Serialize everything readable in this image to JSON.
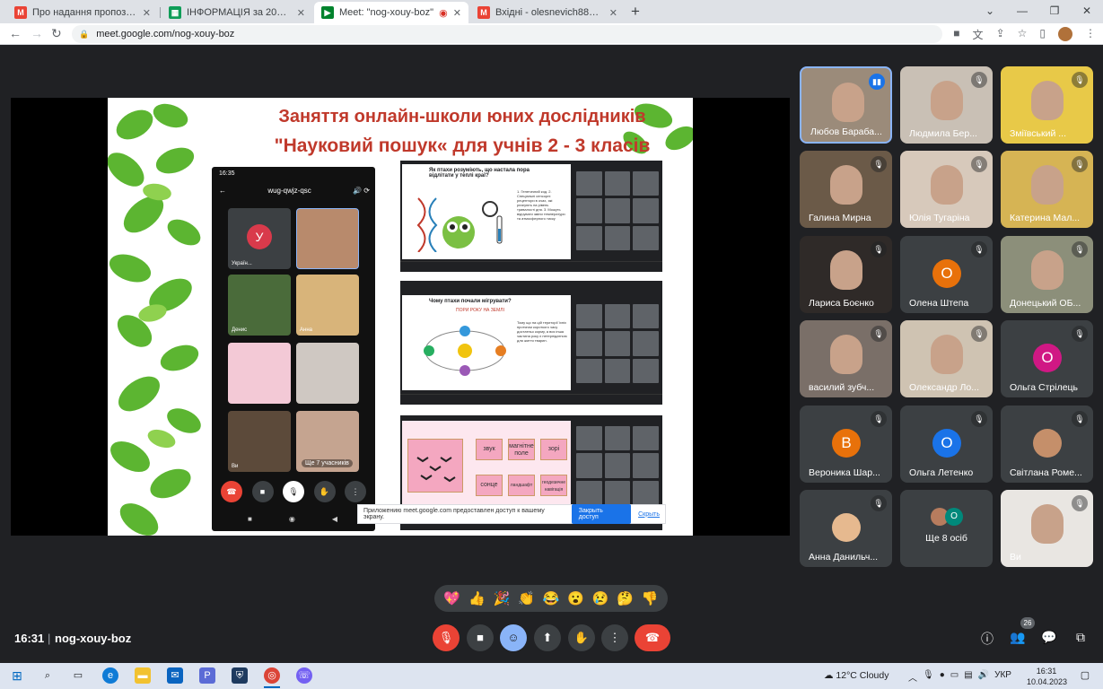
{
  "browser": {
    "tabs": [
      {
        "title": "Про надання пропозицій 10.04",
        "favicon": "gmail-icon",
        "active": false
      },
      {
        "title": "ІНФОРМАЦІЯ за 2023 - Google",
        "favicon": "sheets-icon",
        "active": false
      },
      {
        "title": "Meet: \"nog-xouy-boz\"",
        "favicon": "meet-icon",
        "active": true
      },
      {
        "title": "Вхідні - olesnevich88a@gmail.co",
        "favicon": "gmail-icon",
        "active": false
      }
    ],
    "url": "meet.google.com/nog-xouy-boz",
    "new_tab_label": "+"
  },
  "slide": {
    "title_line1": "Заняття онлайн-школи юних дослідників",
    "title_line2": "\"Науковий пошук« для учнів 2 - 3 класів",
    "phone": {
      "status_time": "16:35",
      "meeting_code": "wug-qwjz-qsc",
      "tile_avatar_letter": "У",
      "names": [
        "Україн...",
        "Денис",
        "Анна",
        "Ви"
      ],
      "more_label": "Ще 7 учасників"
    },
    "screen1": {
      "title": "Як птахи розуміють, що настала пора відлітати у теплі краї?",
      "points": "1. Генетичний код. 2. Спеціальні сенсорні рецептори в очах, які реагують на рівень тривалості дня. 3. Можуть відчувати зміни температури та атмосферного тиску"
    },
    "screen2": {
      "title": "Чому птахи почали мігрувати?",
      "subtitle": "ПОРИ РОКУ НА ЗЕМЛІ",
      "body": "Тому що на цій території їхніх протягом короткого часу достатньо корму, а вся інша частина року є нетерпідатною для життя тварин."
    },
    "screen3": {
      "cards": [
        "звук",
        "магнітне поле",
        "зорі",
        "сонце",
        "ландшафт",
        "геодезичне навігація"
      ]
    },
    "share_notice": {
      "text": "Приложению meet.google.com предоставлен доступ к вашему экрану.",
      "stop_label": "Закрыть доступ",
      "hide_label": "Скрыть"
    }
  },
  "participants": [
    {
      "name": "Любов Бараба...",
      "type": "video",
      "speaking": true
    },
    {
      "name": "Людмила Бер...",
      "type": "video"
    },
    {
      "name": "Зміївський ...",
      "type": "video"
    },
    {
      "name": "Галина Мирна",
      "type": "video"
    },
    {
      "name": "Юлія Тугаріна",
      "type": "video"
    },
    {
      "name": "Катерина Мал...",
      "type": "video"
    },
    {
      "name": "Лариса Боєнко",
      "type": "video"
    },
    {
      "name": "Олена Штепа",
      "type": "avatar",
      "letter": "О",
      "color": "#e8710a"
    },
    {
      "name": "Донецький ОБ...",
      "type": "video"
    },
    {
      "name": "василий зубч...",
      "type": "video"
    },
    {
      "name": "Олександр Ло...",
      "type": "video"
    },
    {
      "name": "Ольга Стрілець",
      "type": "avatar",
      "letter": "О",
      "color": "#d01884"
    },
    {
      "name": "Вероника Шар...",
      "type": "avatar",
      "letter": "В",
      "color": "#e8710a"
    },
    {
      "name": "Ольга Летенко",
      "type": "avatar",
      "letter": "О",
      "color": "#1a73e8"
    },
    {
      "name": "Світлана Роме...",
      "type": "photo",
      "color": "#c58f6a"
    },
    {
      "name": "Анна Данильч...",
      "type": "photo",
      "color": "#e6b98f"
    },
    {
      "name": "Ще 8 осіб",
      "type": "more",
      "letter": "О"
    },
    {
      "name": "Ви",
      "type": "video"
    }
  ],
  "reactions": [
    "💖",
    "👍",
    "🎉",
    "👏",
    "😂",
    "😮",
    "😢",
    "🤔",
    "👎"
  ],
  "meeting": {
    "time": "16:31",
    "separator": "|",
    "code": "nog-xouy-boz",
    "people_count": "26"
  },
  "taskbar": {
    "weather": "12°C  Cloudy",
    "lang": "УКР",
    "time": "16:31",
    "date": "10.04.2023"
  }
}
